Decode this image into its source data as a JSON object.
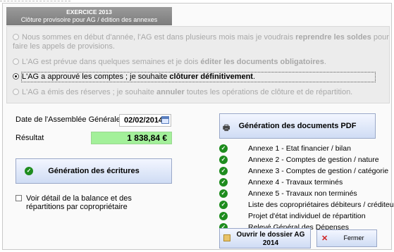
{
  "header": {
    "title": "EXERCICE 2013",
    "subtitle": "Clôture provisoire pour AG / édition des annexes"
  },
  "options": [
    {
      "pre": "Nous sommes en début d'année, l'AG est dans plusieurs mois mais je voudrais ",
      "bold": "reprendre les soldes",
      "post": " pour",
      "line2": "faire les appels de provisions.",
      "state": "disabled"
    },
    {
      "pre": "L'AG est prévue dans quelques semaines et je dois ",
      "bold": "éditer les documents obligatoires",
      "post": ".",
      "state": "disabled"
    },
    {
      "pre": "L'AG a approuvé les comptes ; je souhaite ",
      "bold": "clôturer définitivement",
      "post": ".",
      "state": "selected"
    },
    {
      "pre": "L'AG a émis des réserves ; je souhaite ",
      "bold": "annuler",
      "post": " toutes les opérations de clôture et de répartition.",
      "state": "disabled"
    }
  ],
  "form": {
    "date_label": "Date de l'Assemblée Générale",
    "date_value": "02/02/2014",
    "result_label": "Résultat",
    "result_value": "1 838,84 €"
  },
  "buttons": {
    "generate_entries": "Génération des écritures",
    "generate_pdf": "Génération des documents PDF",
    "open_folder_line1": "Ouvrir le dossier AG",
    "open_folder_line2": "2014",
    "close": "Fermer"
  },
  "checkbox": {
    "line1": "Voir détail de la balance et des",
    "line2": "répartitions par copropriétaire"
  },
  "annexes": [
    "Annexe 1 - Etat financier / bilan",
    "Annexe 2 - Comptes de gestion / nature",
    "Annexe 3 - Comptes de gestion / catégorie",
    "Annexe 4 - Travaux terminés",
    "Annexe 5 - Travaux non terminés",
    "Liste des copropriétaires débiteurs / créditeurs",
    "Projet d'état individuel de répartition",
    "Relevé Général des Dépenses"
  ],
  "colors": {
    "header_bg": "#8a8a8a",
    "result_bg": "#a3f09a",
    "check_green": "#1e8c1e",
    "button_gradient_bottom": "#cfdcf4"
  },
  "icons": {
    "check": "check-circle-icon",
    "printer": "printer-icon",
    "folder": "folder-icon",
    "close": "close-x-icon",
    "calendar": "calendar-icon"
  }
}
